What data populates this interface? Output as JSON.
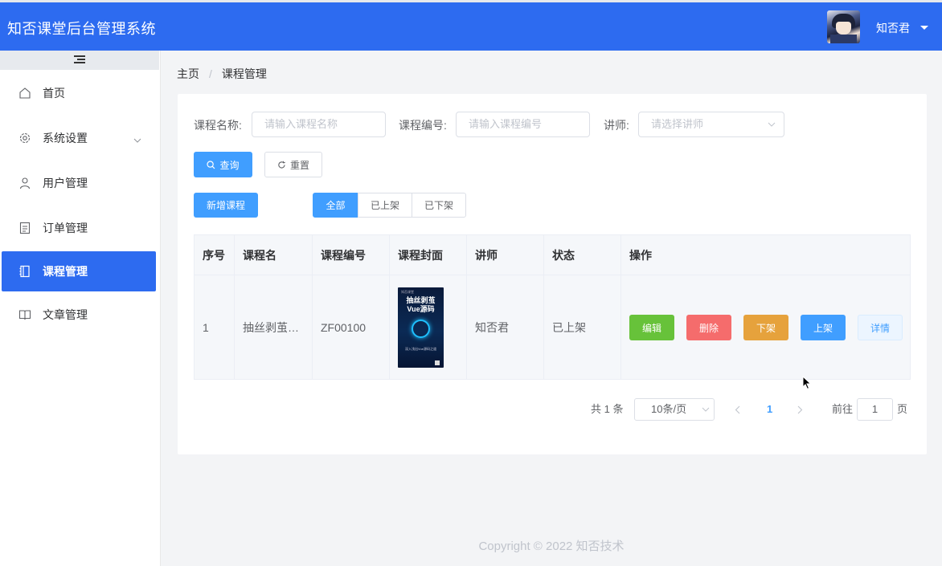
{
  "header": {
    "title": "知否课堂后台管理系统",
    "username": "知否君"
  },
  "sidebar": {
    "items": [
      {
        "label": "首页",
        "icon": "home-icon"
      },
      {
        "label": "系统设置",
        "icon": "gear-icon"
      },
      {
        "label": "用户管理",
        "icon": "user-icon"
      },
      {
        "label": "订单管理",
        "icon": "document-icon"
      },
      {
        "label": "课程管理",
        "icon": "notebook-icon",
        "active": true
      },
      {
        "label": "文章管理",
        "icon": "book-icon"
      }
    ]
  },
  "breadcrumb": {
    "home": "主页",
    "current": "课程管理"
  },
  "filters": {
    "name_label": "课程名称:",
    "name_placeholder": "请输入课程名称",
    "code_label": "课程编号:",
    "code_placeholder": "请输入课程编号",
    "teacher_label": "讲师:",
    "teacher_placeholder": "请选择讲师",
    "search_label": "查询",
    "reset_label": "重置"
  },
  "toolbar": {
    "add_label": "新增课程",
    "tabs": [
      "全部",
      "已上架",
      "已下架"
    ],
    "active_tab": "全部"
  },
  "table": {
    "columns": [
      "序号",
      "课程名",
      "课程编号",
      "课程封面",
      "讲师",
      "状态",
      "操作"
    ],
    "rows": [
      {
        "index": "1",
        "name": "抽丝剥茧…",
        "code": "ZF00100",
        "cover": {
          "brand": "知否课堂",
          "title_line1": "抽丝剥茧",
          "title_line2": "Vue源码",
          "subtitle": "深入浅出Vue源码之道"
        },
        "teacher": "知否君",
        "status": "已上架",
        "actions": [
          "编辑",
          "删除",
          "下架",
          "上架",
          "详情"
        ]
      }
    ]
  },
  "pagination": {
    "total": "共 1 条",
    "page_size": "10条/页",
    "current_page": "1",
    "goto_label": "前往",
    "goto_value": "1",
    "page_suffix": "页"
  },
  "footer": {
    "copyright": "Copyright © 2022 知否技术"
  },
  "colors": {
    "header": "#2d6bf0",
    "primary": "#409eff",
    "success": "#67c23a",
    "danger": "#f56c6c",
    "warning": "#e6a23c"
  }
}
